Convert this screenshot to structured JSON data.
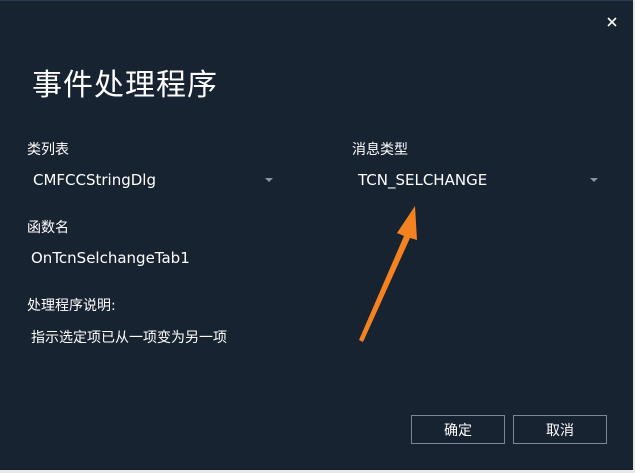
{
  "dialog": {
    "title": "事件处理程序",
    "close_icon": "close-icon"
  },
  "class_list": {
    "label": "类列表",
    "selected": "CMFCCStringDlg"
  },
  "message_type": {
    "label": "消息类型",
    "selected": "TCN_SELCHANGE"
  },
  "function_name": {
    "label": "函数名",
    "value": "OnTcnSelchangeTab1"
  },
  "handler_description": {
    "label": "处理程序说明:",
    "value": "指示选定项已从一项变为另一项"
  },
  "buttons": {
    "ok_label": "确定",
    "cancel_label": "取消"
  },
  "colors": {
    "background": "#182332",
    "text": "#ffffff",
    "caret": "#8a96a3",
    "button_border": "#7d8793",
    "annotation_arrow": "#f58220"
  }
}
